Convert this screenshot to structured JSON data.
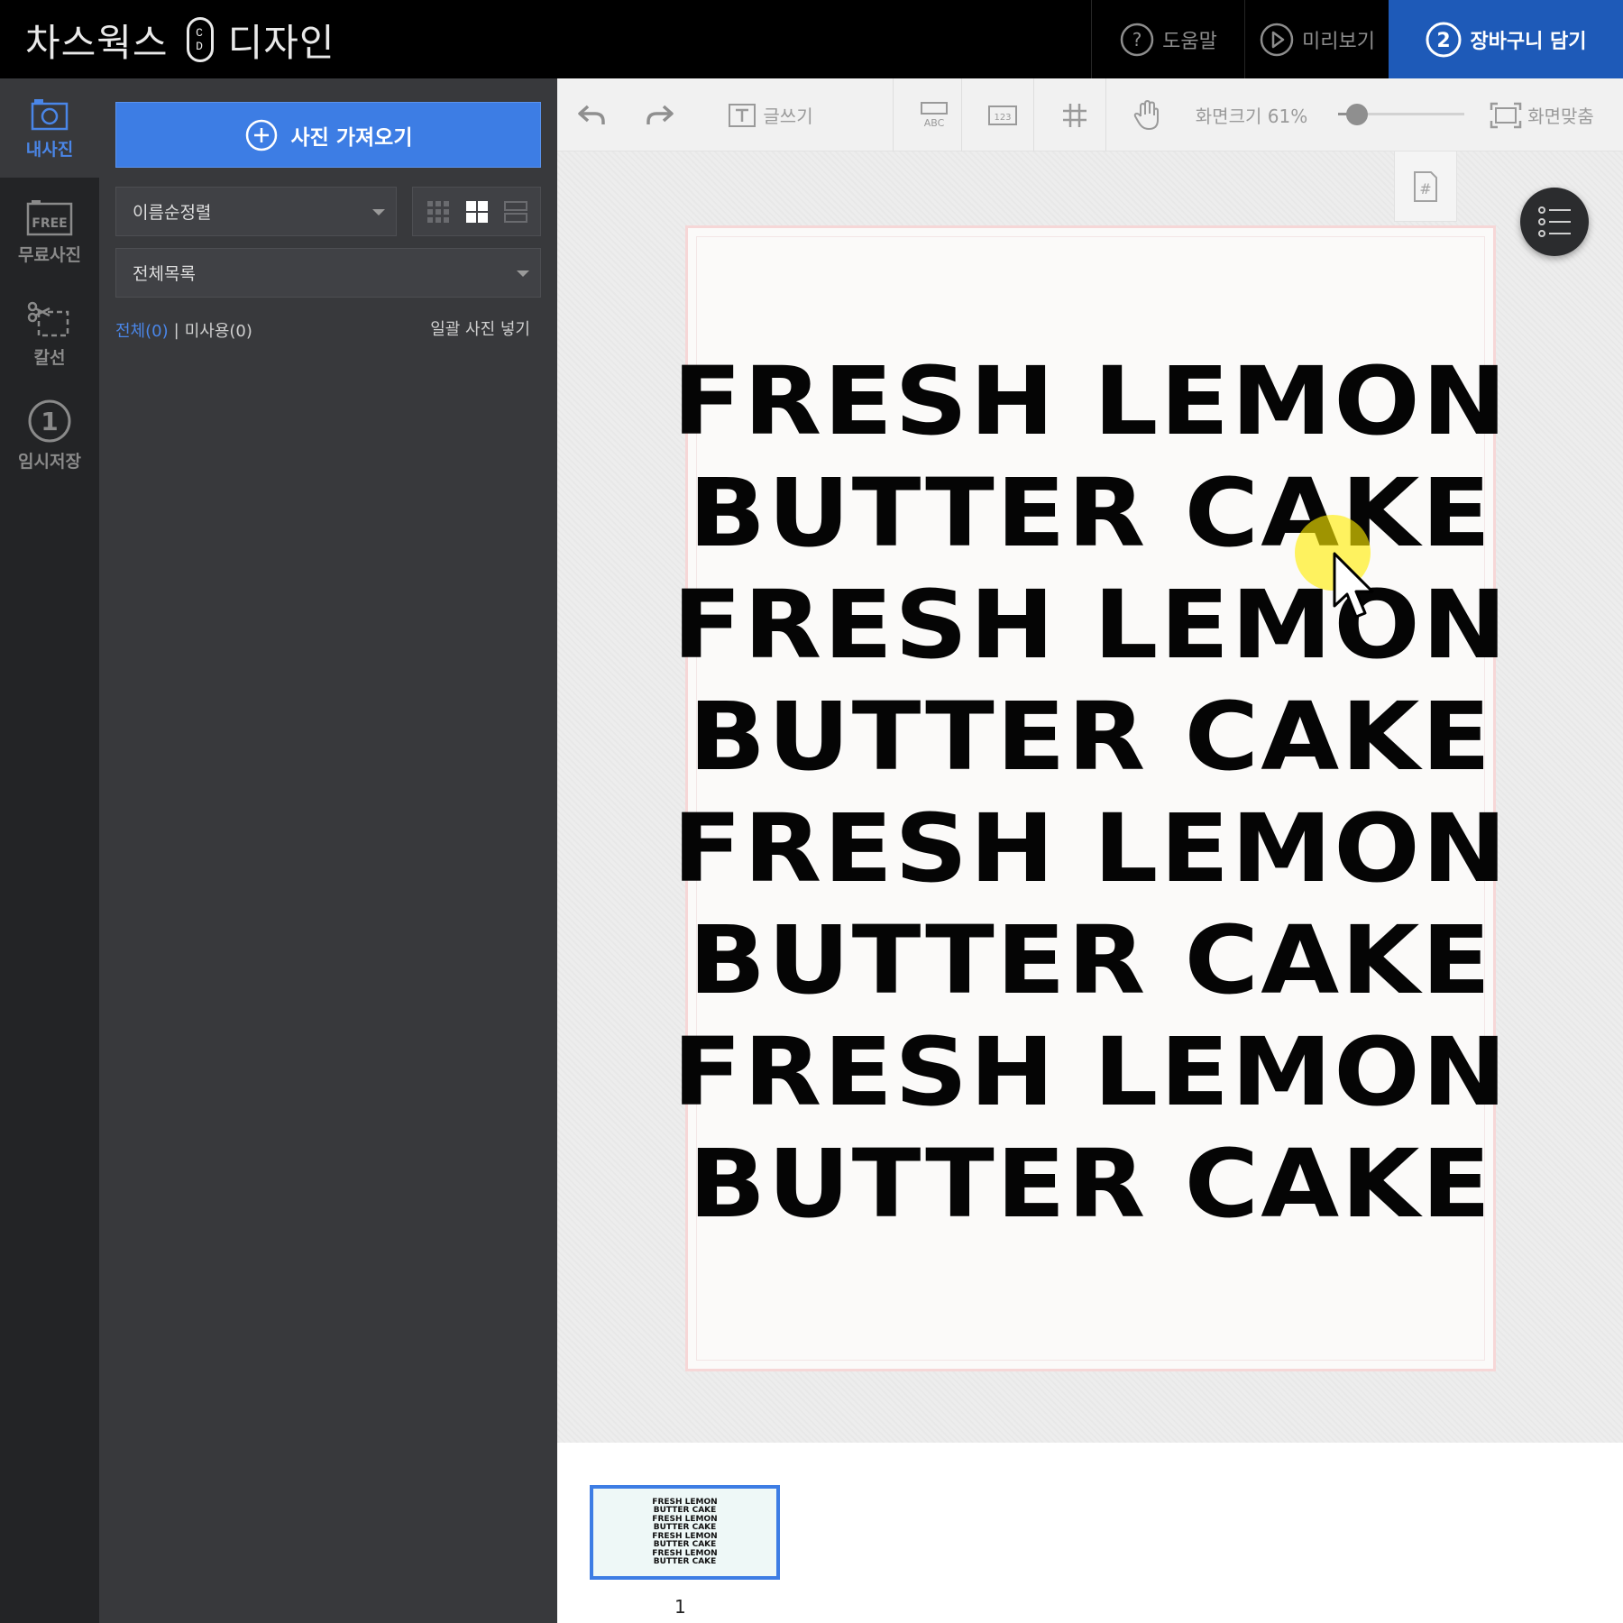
{
  "app": {
    "brand_left": "차스웍스",
    "brand_badge_top": "C",
    "brand_badge_bottom": "D",
    "brand_right": "디자인"
  },
  "topbar": {
    "help_label": "도움말",
    "preview_label": "미리보기",
    "cart_step": "2",
    "cart_label": "장바구니 담기"
  },
  "rail": {
    "items": [
      {
        "label": "내사진",
        "icon": "camera-icon",
        "active": true
      },
      {
        "label": "무료사진",
        "icon": "free-photo-icon",
        "badge": "FREE"
      },
      {
        "label": "칼선",
        "icon": "scissors-icon"
      },
      {
        "label": "임시저장",
        "icon": "step-one-icon",
        "badge": "1"
      }
    ]
  },
  "panel": {
    "import_label": "사진 가져오기",
    "sort_value": "이름순정렬",
    "list_value": "전체목록",
    "filter_all": "전체(0)",
    "filter_sep": "|",
    "filter_unused": "미사용(0)",
    "bulk_insert": "일괄 사진 넣기"
  },
  "toolbar": {
    "text_label": "글쓰기",
    "abc_label": "ABC",
    "num_label": "123",
    "zoom_label": "화면크기 61%",
    "zoom_value": 0.15,
    "fit_label": "화면맞춤",
    "page_number_icon_label": "#"
  },
  "design": {
    "lines": [
      "FRESH LEMON",
      "BUTTER CAKE",
      "FRESH LEMON",
      "BUTTER CAKE",
      "FRESH LEMON",
      "BUTTER CAKE",
      "FRESH LEMON",
      "BUTTER CAKE"
    ]
  },
  "thumbs": {
    "index": "1"
  },
  "colors": {
    "accent": "#3d7de4",
    "cart": "#1e5ab8",
    "active_rail": "#4a86e8",
    "cursor_highlight": "#ffee00"
  }
}
